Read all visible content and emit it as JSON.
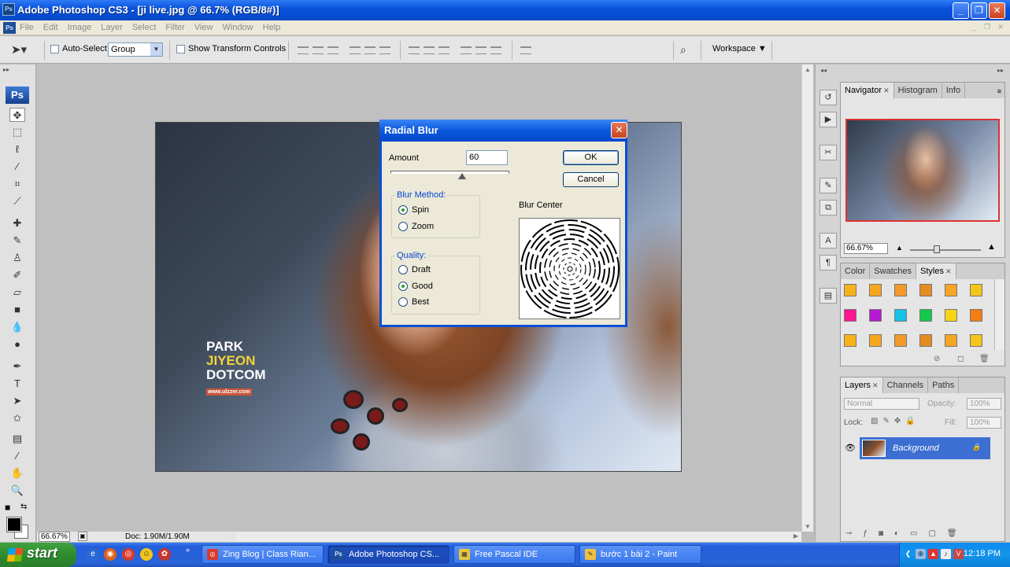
{
  "window": {
    "title": "Adobe Photoshop CS3 - [ji live.jpg @ 66.7% (RGB/8#)]",
    "app_icon": "Ps",
    "minimize": "_",
    "maximize": "❐",
    "close": "✕"
  },
  "menu": [
    "File",
    "Edit",
    "Image",
    "Layer",
    "Select",
    "Filter",
    "View",
    "Window",
    "Help"
  ],
  "options": {
    "auto_select_label": "Auto-Select:",
    "auto_select_value": "Group",
    "show_transform_label": "Show Transform Controls",
    "workspace_label": "Workspace ▼"
  },
  "toolbox": {
    "logo": "Ps"
  },
  "photo": {
    "logo_line1": "PARK",
    "logo_line2": "JIYEON",
    "logo_line3": "DOTCOM",
    "logo_web": "www.ulzzer.com"
  },
  "status": {
    "zoom": "66.67%",
    "doc_size": "Doc: 1.90M/1.90M"
  },
  "panels": {
    "navigator_tabs": [
      "Navigator",
      "Histogram",
      "Info"
    ],
    "navigator_zoom": "66.67%",
    "color_tabs": [
      "Color",
      "Swatches",
      "Styles"
    ],
    "layers_tabs": [
      "Layers",
      "Channels",
      "Paths"
    ],
    "blend_mode": "Normal",
    "opacity_label": "Opacity:",
    "opacity_value": "100%",
    "lock_label": "Lock:",
    "fill_label": "Fill:",
    "fill_value": "100%",
    "layer_name": "Background",
    "style_colors": [
      "#f7b21a",
      "#f7a71d",
      "#f39a2b",
      "#e58c1f",
      "#f5a623",
      "#f4c51a",
      "#ff1493",
      "#b21bd0",
      "#16c2e6",
      "#12c94a",
      "#f6d416",
      "#f47c12"
    ]
  },
  "dialog": {
    "title": "Radial Blur",
    "amount_label": "Amount",
    "amount_value": "60",
    "ok": "OK",
    "cancel": "Cancel",
    "blur_method_label": "Blur Method:",
    "method_spin": "Spin",
    "method_zoom": "Zoom",
    "selected_method": "Spin",
    "quality_label": "Quality:",
    "quality_draft": "Draft",
    "quality_good": "Good",
    "quality_best": "Best",
    "selected_quality": "Good",
    "blur_center_label": "Blur Center"
  },
  "taskbar": {
    "start": "start",
    "tasks": [
      {
        "label": "Zing Blog | Class Rian...",
        "icon": "chrome-icon"
      },
      {
        "label": "Adobe Photoshop CS...",
        "icon": "photoshop-icon",
        "active": true
      },
      {
        "label": "Free Pascal IDE",
        "icon": "pascal-icon"
      },
      {
        "label": "bước 1 bài 2 - Paint",
        "icon": "paint-icon"
      }
    ],
    "clock": "12:18 PM"
  }
}
